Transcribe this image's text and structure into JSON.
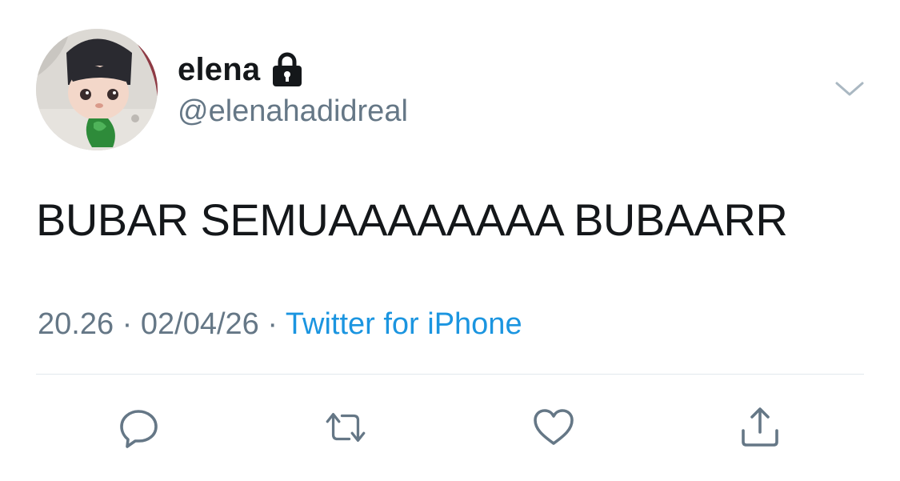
{
  "tweet": {
    "display_name": "elena",
    "handle": "@elenahadidreal",
    "text": "BUBAR SEMUAAAAAAAA BUBAARR",
    "time": "20.26",
    "separator": " · ",
    "date": "02/04/26",
    "source": "Twitter for iPhone",
    "protected_icon": "lock-icon",
    "menu_icon": "chevron-down-icon"
  },
  "actions": [
    {
      "icon": "reply-icon"
    },
    {
      "icon": "retweet-icon"
    },
    {
      "icon": "like-icon"
    },
    {
      "icon": "share-icon"
    }
  ],
  "colors": {
    "text": "#14171a",
    "secondary": "#657786",
    "link": "#1b95e0",
    "divider": "#e1e8ed",
    "icon": "#657786"
  }
}
